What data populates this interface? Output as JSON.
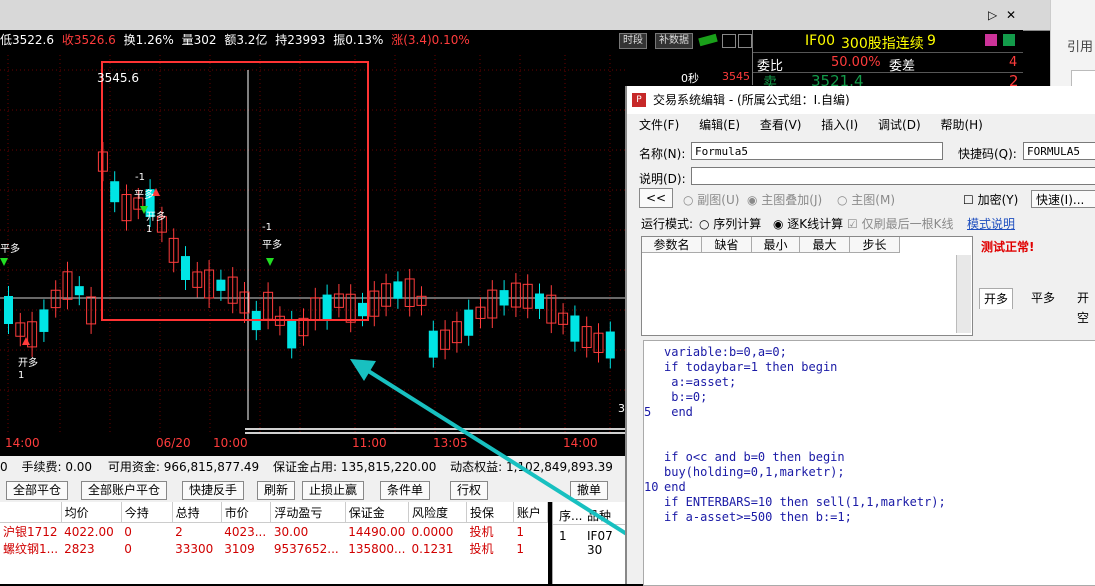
{
  "window": {
    "ctrl_play": "▷",
    "ctrl_close": "✕"
  },
  "infobar": {
    "low": "低3522.6",
    "close": "收3526.6",
    "turnover": "换1.26%",
    "volume": "量302",
    "amount": "额3.2亿",
    "openint": "持23993",
    "amplitude": "振0.13%",
    "change": "涨(3.4)0.10%",
    "btn_time": "时段",
    "btn_fill": "补数据"
  },
  "quote": {
    "code": "IF00",
    "name": "300股指连续",
    "num": "9",
    "weibi_label": "委比",
    "weibi_value": "50.00%",
    "weicha_label": "委差",
    "weicha_value": "4",
    "sell_label": "卖",
    "sell_price": "3521.4",
    "sell_vol": "2"
  },
  "rightside": {
    "ref_text": "引用"
  },
  "chart": {
    "price_top": "3545.6",
    "seconds": "0秒",
    "axis_price": "3545",
    "right_mark": "3",
    "x_labels": [
      "14:00",
      "06/20",
      "10:00",
      "11:00",
      "13:05",
      "14:00"
    ],
    "signals": [
      {
        "text": "-1",
        "sub": "平多"
      },
      {
        "text": "开多",
        "sub": "1"
      },
      {
        "text": "-1",
        "sub": "平多"
      },
      {
        "text": "平多",
        "sub": ""
      },
      {
        "text": "开多",
        "sub": "1"
      }
    ]
  },
  "chart_data": {
    "type": "candlestick",
    "y_top_label": 3545.6,
    "colors": {
      "up": "#ff3c3c",
      "down": "#00e5e5",
      "box": "#ff3333",
      "arrow": "#18c0c0"
    }
  },
  "account": {
    "fee_label": "手续费:",
    "fee": "0.00",
    "avail_label": "可用资金:",
    "avail": "966,815,877.49",
    "margin_label": "保证金占用:",
    "margin": "135,815,220.00",
    "equity_label": "动态权益:",
    "equity": "1,102,849,893.39",
    "lead_digit": "0"
  },
  "buttons": [
    "全部平仓",
    "全部账户平仓",
    "快捷反手",
    "刷新",
    "止损止赢",
    "条件单",
    "行权",
    "撤单"
  ],
  "positions": {
    "headers": [
      "均价",
      "今持",
      "总持",
      "市价",
      "浮动盈亏",
      "保证金",
      "风险度",
      "投保",
      "账户"
    ],
    "rows": [
      {
        "name": "沪银1712",
        "avg": "4022.00",
        "today": "0",
        "total": "2",
        "price": "4023...",
        "pnl": "30.00",
        "margin": "14490.00",
        "risk": "0.0000",
        "hedge": "投机",
        "acct": "1"
      },
      {
        "name": "螺纹钢1...",
        "avg": "2823",
        "today": "0",
        "total": "33300",
        "price": "3109",
        "pnl": "9537652...",
        "margin": "135800...",
        "risk": "0.1231",
        "hedge": "投机",
        "acct": "1"
      }
    ]
  },
  "orders": {
    "headers": [
      "序...",
      "品种"
    ],
    "row": [
      "1",
      "IF07 30"
    ]
  },
  "dialog": {
    "title": "交易系统编辑 - (所属公式组：I.自编)",
    "menu": [
      "文件(F)",
      "编辑(E)",
      "查看(V)",
      "插入(I)",
      "调试(D)",
      "帮助(H)"
    ],
    "name_label": "名称(N):",
    "name_value": "Formula5",
    "hotkey_label": "快捷码(Q):",
    "hotkey_value": "FORMULA5",
    "desc_label": "说明(D):",
    "back_btn": "<<",
    "opt_sub": "副图(U)",
    "opt_overlay": "主图叠加(J)",
    "opt_main": "主图(M)",
    "encrypt": "加密(Y)",
    "quick_btn": "快速(I)...",
    "mode_label": "运行模式:",
    "mode_seq": "序列计算",
    "mode_bar": "逐K线计算",
    "mode_last": "仅刷最后一根K线",
    "mode_help": "模式说明",
    "param_headers": [
      "参数名",
      "缺省",
      "最小",
      "最大",
      "步长"
    ],
    "test_ok": "测试正常!",
    "tabs": [
      "开多",
      "平多",
      "开空"
    ],
    "code_lines": [
      {
        "ln": "",
        "text": "variable:b=0,a=0;"
      },
      {
        "ln": "",
        "text": "if todaybar=1 then begin"
      },
      {
        "ln": "",
        "text": " a:=asset;"
      },
      {
        "ln": "",
        "text": " b:=0;"
      },
      {
        "ln": "5",
        "text": " end"
      },
      {
        "ln": "",
        "text": ""
      },
      {
        "ln": "",
        "text": ""
      },
      {
        "ln": "",
        "text": "if o<c and b=0 then begin"
      },
      {
        "ln": "",
        "text": "buy(holding=0,1,marketr);"
      },
      {
        "ln": "10",
        "text": "end"
      },
      {
        "ln": "",
        "text": "if ENTERBARS=10 then sell(1,1,marketr);"
      },
      {
        "ln": "",
        "text": "if a-asset>=500 then b:=1;"
      }
    ]
  }
}
